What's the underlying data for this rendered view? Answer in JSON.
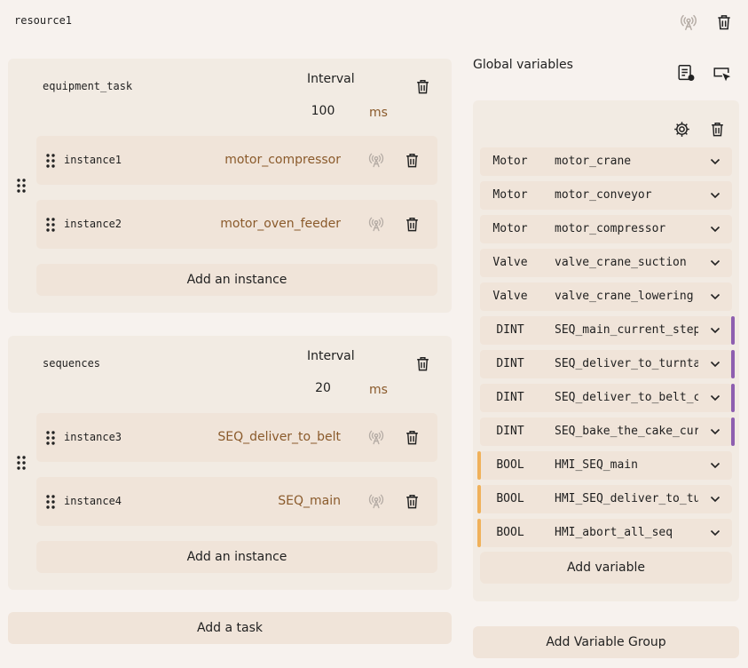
{
  "resource": {
    "name": "resource1"
  },
  "tasks": [
    {
      "name": "equipment_task",
      "interval_label": "Interval",
      "interval_value": "100",
      "unit": "ms",
      "instances": [
        {
          "name": "instance1",
          "program": "motor_compressor"
        },
        {
          "name": "instance2",
          "program": "motor_oven_feeder"
        }
      ],
      "add_instance_label": "Add an instance"
    },
    {
      "name": "sequences",
      "interval_label": "Interval",
      "interval_value": "20",
      "unit": "ms",
      "instances": [
        {
          "name": "instance3",
          "program": "SEQ_deliver_to_belt"
        },
        {
          "name": "instance4",
          "program": "SEQ_main"
        }
      ],
      "add_instance_label": "Add an instance"
    }
  ],
  "add_task_label": "Add a task",
  "globals": {
    "title": "Global variables",
    "variables": [
      {
        "type": "Motor",
        "name": "motor_crane"
      },
      {
        "type": "Motor",
        "name": "motor_conveyor"
      },
      {
        "type": "Motor",
        "name": "motor_compressor"
      },
      {
        "type": "Valve",
        "name": "valve_crane_suction"
      },
      {
        "type": "Valve",
        "name": "valve_crane_lowering"
      },
      {
        "type": "DINT",
        "name": "SEQ_main_current_step"
      },
      {
        "type": "DINT",
        "name": "SEQ_deliver_to_turntable"
      },
      {
        "type": "DINT",
        "name": "SEQ_deliver_to_belt_current_step"
      },
      {
        "type": "DINT",
        "name": "SEQ_bake_the_cake_current_step"
      },
      {
        "type": "BOOL",
        "name": "HMI_SEQ_main"
      },
      {
        "type": "BOOL",
        "name": "HMI_SEQ_deliver_to_turntable"
      },
      {
        "type": "BOOL",
        "name": "HMI_abort_all_seq"
      }
    ],
    "add_variable_label": "Add variable",
    "add_group_label": "Add Variable Group"
  },
  "colors": {
    "accent_text": "#8a5a2b",
    "dint_bar": "#8e5fb0",
    "bool_bar": "#f0b15a",
    "background": "#f7f2ee"
  }
}
